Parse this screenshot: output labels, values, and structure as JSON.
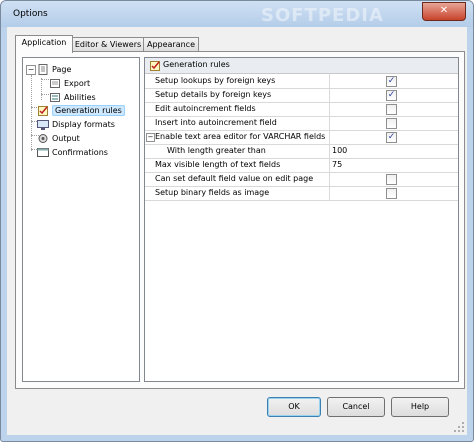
{
  "window": {
    "title": "Options",
    "watermark": "SOFTPEDIA",
    "close_glyph": "✕"
  },
  "tabs": [
    {
      "label": "Application",
      "active": true
    },
    {
      "label": "Editor & Viewers",
      "active": false
    },
    {
      "label": "Appearance",
      "active": false
    }
  ],
  "tree": {
    "expander_glyph": "−",
    "items": [
      {
        "label": "Page",
        "icon": "page-icon"
      },
      {
        "label": "Export",
        "icon": "export-icon"
      },
      {
        "label": "Abilities",
        "icon": "abilities-icon"
      },
      {
        "label": "Generation rules",
        "icon": "generation-rules-icon",
        "selected": true
      },
      {
        "label": "Display formats",
        "icon": "display-formats-icon"
      },
      {
        "label": "Output",
        "icon": "output-icon"
      },
      {
        "label": "Confirmations",
        "icon": "confirmations-icon"
      }
    ]
  },
  "grid": {
    "header": "Generation rules",
    "check_glyph": "✓",
    "collapse_glyph": "−",
    "rows": [
      {
        "label": "Setup lookups by foreign keys",
        "type": "check",
        "checked": true
      },
      {
        "label": "Setup details by foreign keys",
        "type": "check",
        "checked": true
      },
      {
        "label": "Edit autoincrement fields",
        "type": "check",
        "checked": false
      },
      {
        "label": "Insert into autoincrement field",
        "type": "check",
        "checked": false
      },
      {
        "label": "Enable text area editor for VARCHAR fields",
        "type": "check",
        "checked": true
      },
      {
        "label": "With length greater than",
        "type": "value",
        "value": "100"
      },
      {
        "label": "Max visible length of text fields",
        "type": "value",
        "value": "75"
      },
      {
        "label": "Can set default field value on edit page",
        "type": "check",
        "checked": false
      },
      {
        "label": "Setup binary fields as image",
        "type": "check",
        "checked": false
      }
    ]
  },
  "buttons": {
    "ok": "OK",
    "cancel": "Cancel",
    "help": "Help"
  }
}
